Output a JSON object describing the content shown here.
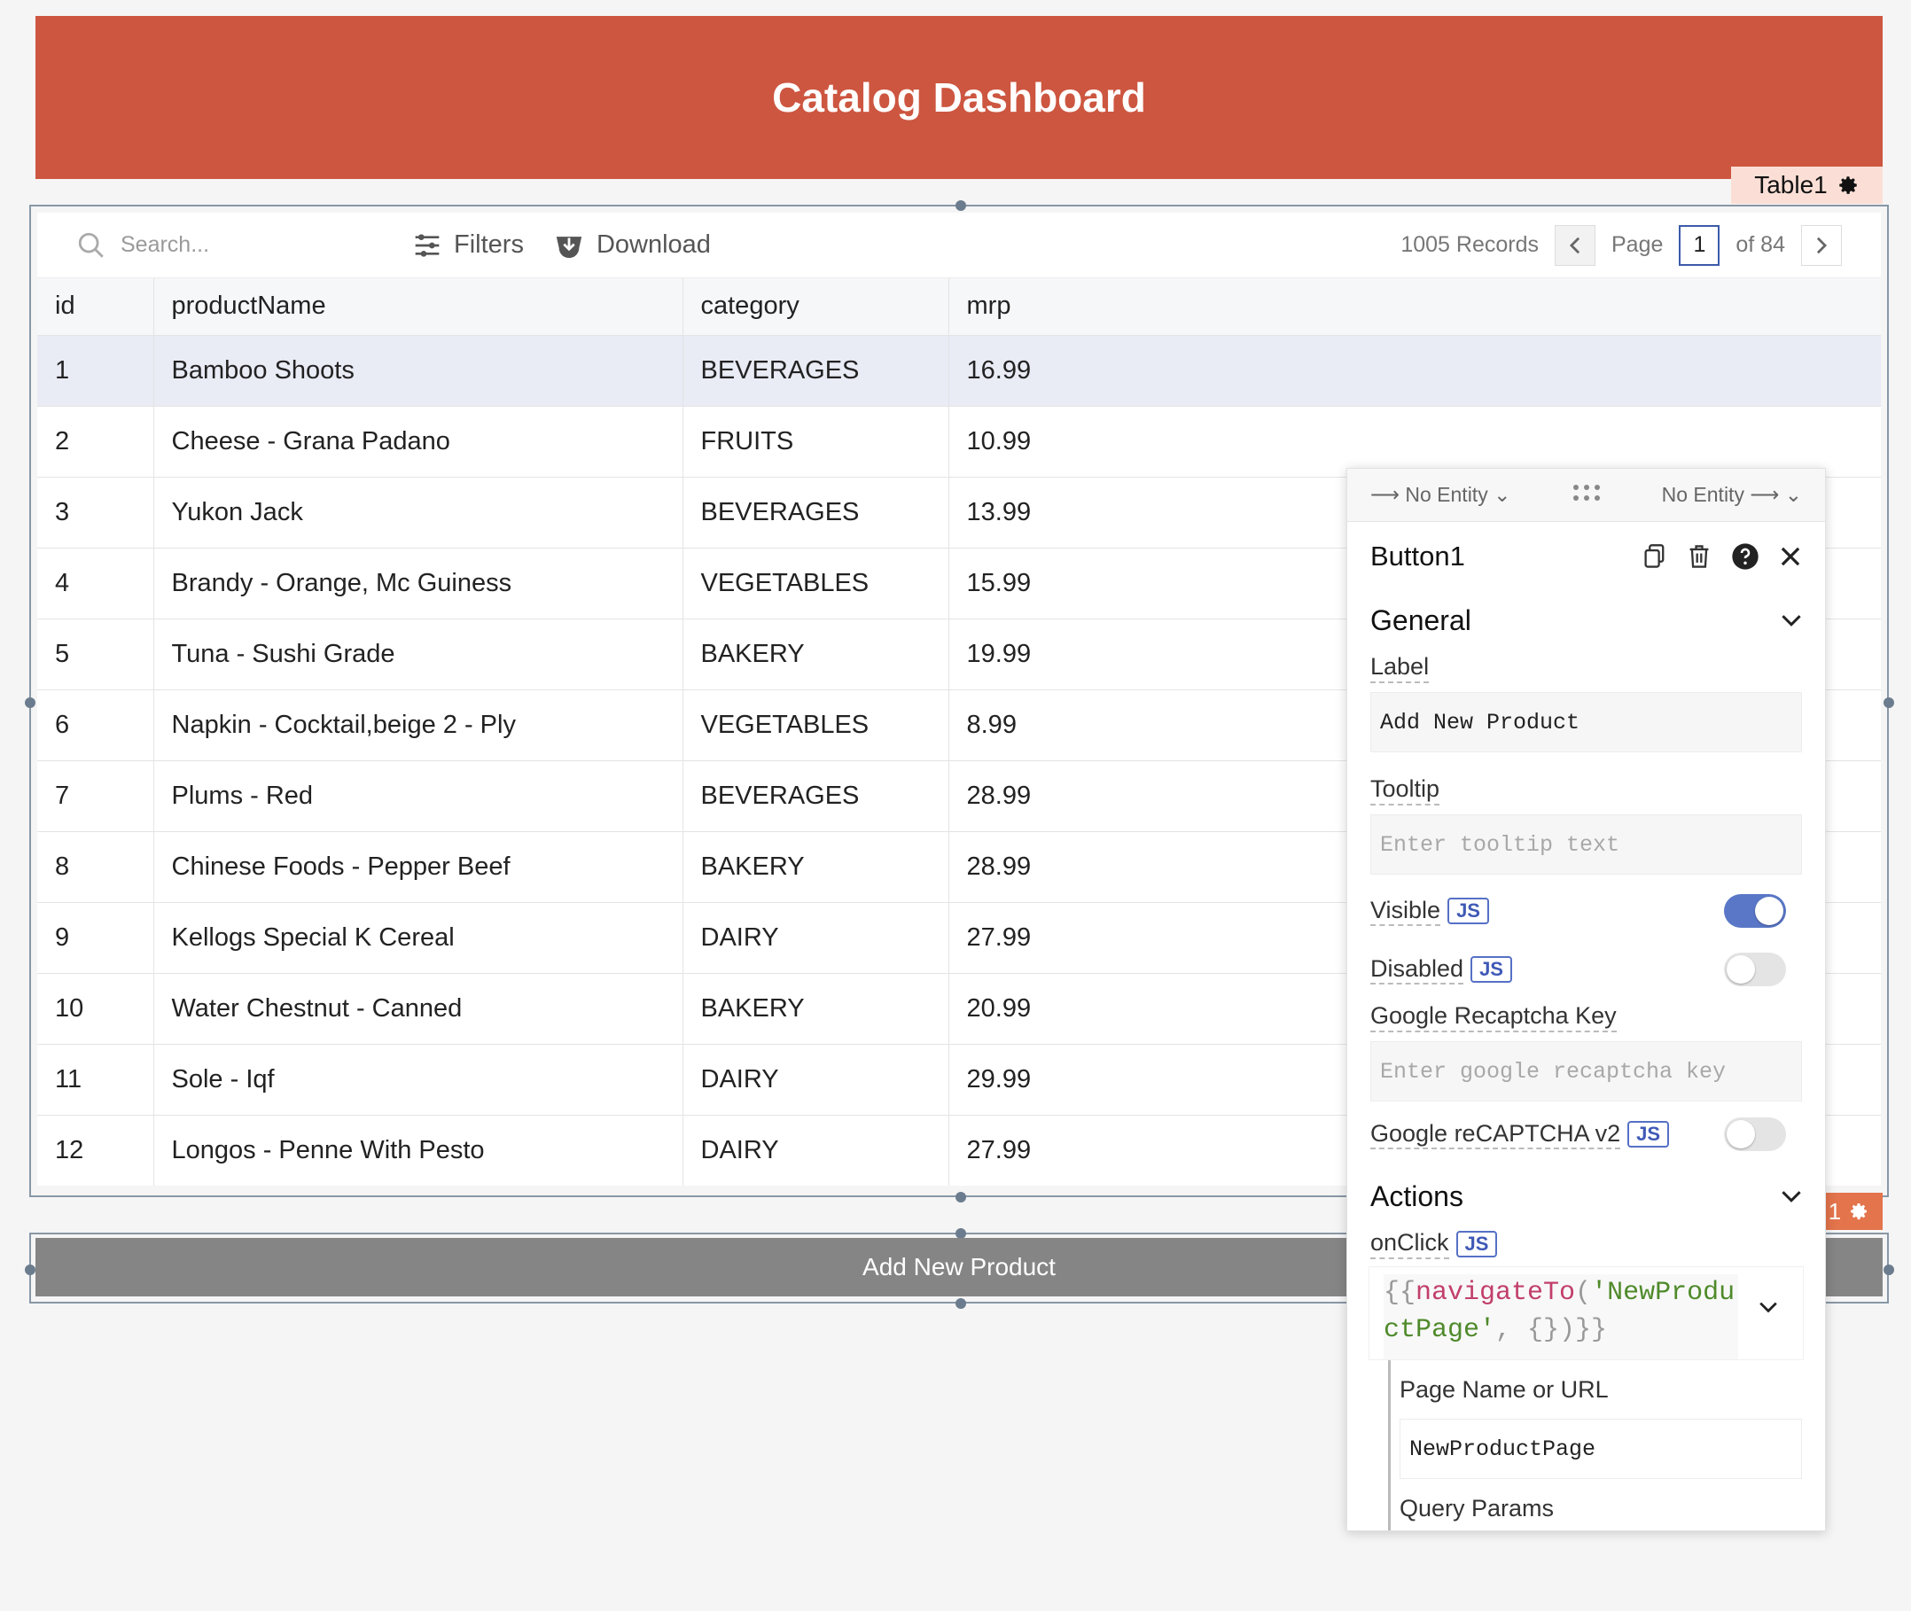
{
  "header": {
    "title": "Catalog Dashboard"
  },
  "table_tag": {
    "label": "Table1"
  },
  "toolbar": {
    "search_placeholder": "Search...",
    "filters_label": "Filters",
    "download_label": "Download",
    "records": "1005 Records",
    "page_label": "Page",
    "page_value": "1",
    "of_pages": "of 84"
  },
  "table": {
    "columns": [
      "id",
      "productName",
      "category",
      "mrp"
    ],
    "rows": [
      [
        "1",
        "Bamboo Shoots",
        "BEVERAGES",
        "16.99"
      ],
      [
        "2",
        "Cheese - Grana Padano",
        "FRUITS",
        "10.99"
      ],
      [
        "3",
        "Yukon Jack",
        "BEVERAGES",
        "13.99"
      ],
      [
        "4",
        "Brandy - Orange, Mc Guiness",
        "VEGETABLES",
        "15.99"
      ],
      [
        "5",
        "Tuna - Sushi Grade",
        "BAKERY",
        "19.99"
      ],
      [
        "6",
        "Napkin - Cocktail,beige 2 - Ply",
        "VEGETABLES",
        "8.99"
      ],
      [
        "7",
        "Plums - Red",
        "BEVERAGES",
        "28.99"
      ],
      [
        "8",
        "Chinese Foods - Pepper Beef",
        "BAKERY",
        "28.99"
      ],
      [
        "9",
        "Kellogs Special K Cereal",
        "DAIRY",
        "27.99"
      ],
      [
        "10",
        "Water Chestnut - Canned",
        "BAKERY",
        "20.99"
      ],
      [
        "11",
        "Sole - Iqf",
        "DAIRY",
        "29.99"
      ],
      [
        "12",
        "Longos - Penne With Pesto",
        "DAIRY",
        "27.99"
      ]
    ]
  },
  "add_button": {
    "label": "Add New Product"
  },
  "button_tag": {
    "label": "1"
  },
  "panel": {
    "entity_left": "No Entity",
    "entity_right": "No Entity",
    "widget_name": "Button1",
    "general_title": "General",
    "label_title": "Label",
    "label_value": "Add New Product",
    "tooltip_title": "Tooltip",
    "tooltip_placeholder": "Enter tooltip text",
    "visible_label": "Visible",
    "visible_on": true,
    "disabled_label": "Disabled",
    "disabled_on": false,
    "recaptcha_key_title": "Google Recaptcha Key",
    "recaptcha_key_placeholder": "Enter google recaptcha key",
    "recaptcha_v2_label": "Google reCAPTCHA v2",
    "recaptcha_v2_on": false,
    "js_badge": "JS",
    "actions_title": "Actions",
    "onclick_label": "onClick",
    "code_open": "{{",
    "code_fn": "navigateTo",
    "code_paren": "(",
    "code_str": "'NewProductPage'",
    "code_rest": ", {})}}",
    "page_name_title": "Page Name or URL",
    "page_name_value": "NewProductPage",
    "query_params_title": "Query Params"
  },
  "colors": {
    "header_bg": "#cd5640",
    "accent": "#5a77c7",
    "selected_row": "#e9ebf5"
  }
}
